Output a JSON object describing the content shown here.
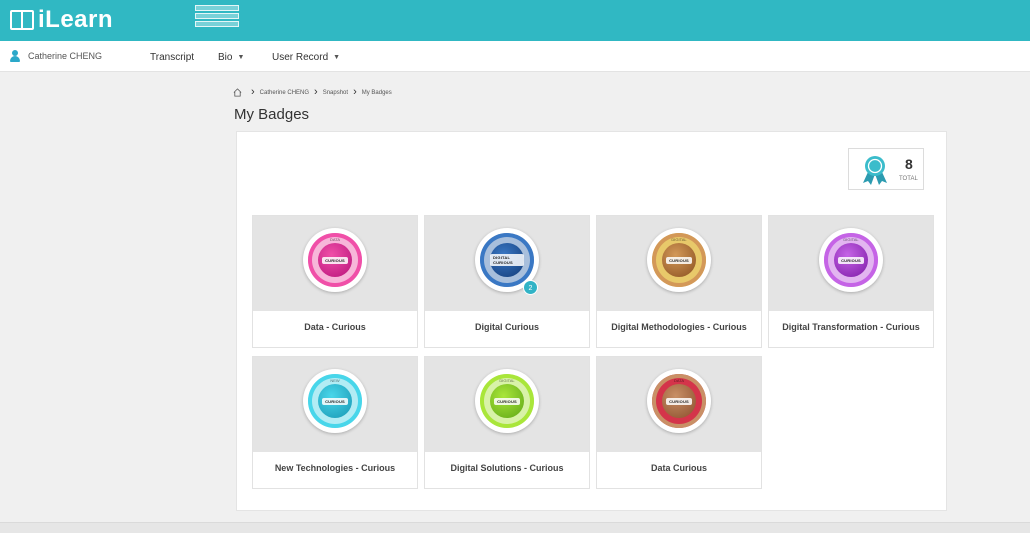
{
  "app": {
    "name": "iLearn",
    "promo_lines": [
      "",
      "",
      ""
    ]
  },
  "user": {
    "name": "Catherine CHENG"
  },
  "nav": [
    {
      "label": "Transcript",
      "has_menu": false
    },
    {
      "label": "Bio",
      "has_menu": true
    },
    {
      "label": "User Record",
      "has_menu": true
    }
  ],
  "breadcrumb": [
    "Catherine CHENG",
    "Snapshot",
    "My Badges"
  ],
  "page": {
    "title": "My Badges"
  },
  "summary": {
    "total": "8",
    "total_label": "TOTAL"
  },
  "badges": [
    {
      "label": "Data - Curious",
      "word": "CURIOUS",
      "top_text": "DATA",
      "colors": [
        "#f04fa8",
        "#b8127a"
      ],
      "rim": "#f7b6d9",
      "count": ""
    },
    {
      "label": "Digital Curious",
      "word": "DIGITAL CURIOUS",
      "top_text": "",
      "colors": [
        "#3a78c4",
        "#123b78"
      ],
      "rim": "#a8bfdc",
      "count": "2"
    },
    {
      "label": "Digital Methodologies - Curious",
      "word": "CURIOUS",
      "top_text": "DIGITAL",
      "colors": [
        "#d39858",
        "#8a5020"
      ],
      "rim": "#e8c96a",
      "count": ""
    },
    {
      "label": "Digital Transformation - Curious",
      "word": "CURIOUS",
      "top_text": "DIGITAL",
      "colors": [
        "#c564e6",
        "#7d1aa6"
      ],
      "rim": "#e2b5f0",
      "count": ""
    },
    {
      "label": "New Technologies - Curious",
      "word": "CURIOUS",
      "top_text": "NEW",
      "colors": [
        "#48d6ea",
        "#1897b3"
      ],
      "rim": "#b2ecf4",
      "count": ""
    },
    {
      "label": "Digital Solutions - Curious",
      "word": "CURIOUS",
      "top_text": "DIGITAL",
      "colors": [
        "#a9e63a",
        "#5ea616"
      ],
      "rim": "#d8f2a8",
      "count": ""
    },
    {
      "label": "Data Curious",
      "word": "CURIOUS",
      "top_text": "DATA",
      "colors": [
        "#c99066",
        "#8a4e2c"
      ],
      "rim": "#d4344a",
      "count": ""
    }
  ]
}
